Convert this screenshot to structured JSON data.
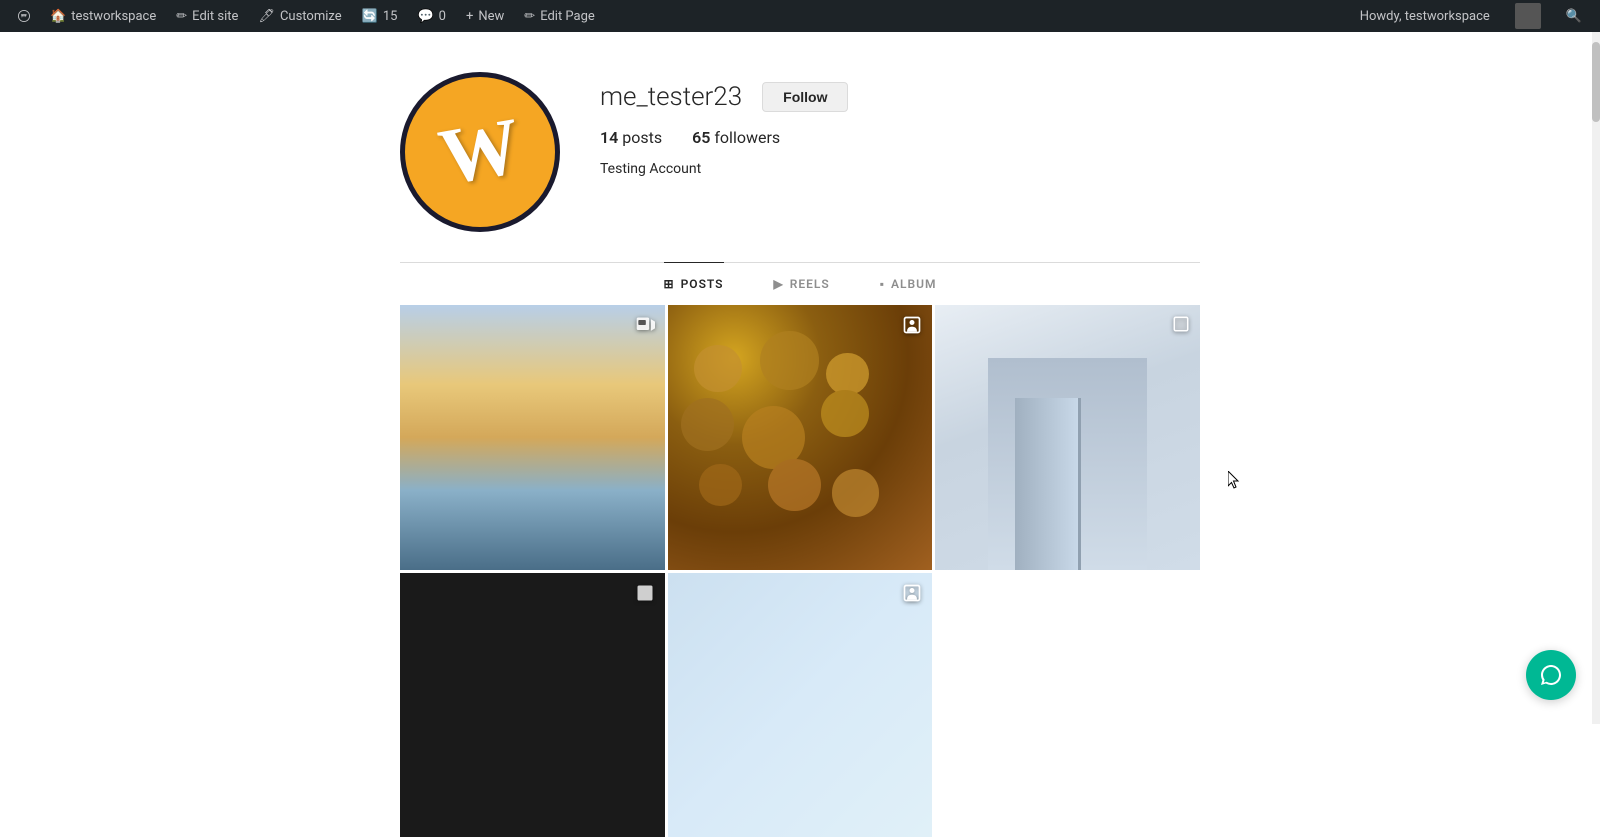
{
  "adminBar": {
    "wpLogo": "W",
    "items": [
      {
        "id": "testworkspace",
        "label": "testworkspace",
        "icon": "🏠"
      },
      {
        "id": "edit-site",
        "label": "Edit site",
        "icon": "✏"
      },
      {
        "id": "customize",
        "label": "Customize",
        "icon": "🖊"
      },
      {
        "id": "updates",
        "label": "15",
        "icon": "🔄"
      },
      {
        "id": "comments",
        "label": "0",
        "icon": "💬"
      },
      {
        "id": "new",
        "label": "New",
        "icon": "+"
      },
      {
        "id": "edit-page",
        "label": "Edit Page",
        "icon": "✏"
      }
    ],
    "right": {
      "howdy": "Howdy, testworkspace",
      "searchIcon": "🔍"
    }
  },
  "profile": {
    "username": "me_tester23",
    "followLabel": "Follow",
    "stats": {
      "posts": "14",
      "postsLabel": "posts",
      "followers": "65",
      "followersLabel": "followers"
    },
    "bio": "Testing Account"
  },
  "tabs": [
    {
      "id": "posts",
      "label": "POSTS",
      "icon": "⊞",
      "active": true
    },
    {
      "id": "reels",
      "label": "REELS",
      "icon": "▶"
    },
    {
      "id": "album",
      "label": "ALBUM",
      "icon": "▪"
    }
  ],
  "posts": [
    {
      "id": "post-1",
      "type": "sky",
      "iconType": "video"
    },
    {
      "id": "post-2",
      "type": "food",
      "iconType": "person"
    },
    {
      "id": "post-3",
      "type": "building",
      "iconType": "square"
    },
    {
      "id": "post-4",
      "type": "black",
      "iconType": "square2"
    },
    {
      "id": "post-5",
      "type": "lightblue",
      "iconType": "person2"
    }
  ]
}
